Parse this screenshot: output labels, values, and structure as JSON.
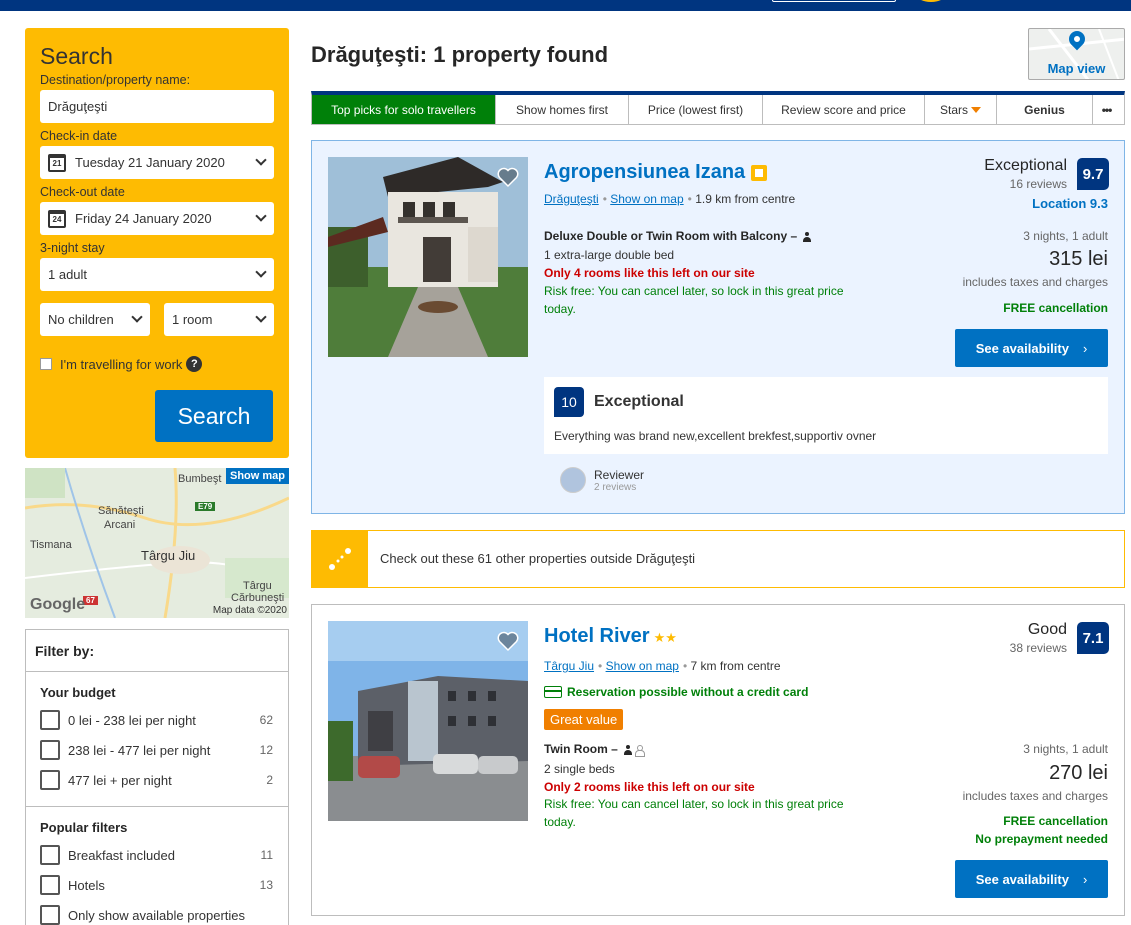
{
  "search": {
    "title": "Search",
    "dest_label": "Destination/property name:",
    "dest_value": "Drăguţeşti",
    "checkin_label": "Check-in date",
    "checkin_day": "21",
    "checkin_value": "Tuesday 21 January 2020",
    "checkout_label": "Check-out date",
    "checkout_day": "24",
    "checkout_value": "Friday 24 January 2020",
    "stay_label": "3-night stay",
    "adults": "1 adult",
    "children": "No children",
    "rooms": "1 room",
    "work_label": "I'm travelling for work",
    "button": "Search"
  },
  "minimap": {
    "show_map": "Show map",
    "towns": [
      "Bumbeşt",
      "Sănăteşti",
      "Arcani",
      "Tismana",
      "Târgu Jiu",
      "Târgu",
      "Cărbuneşti"
    ],
    "road": "E79",
    "road2": "67",
    "google": "Google",
    "map_data": "Map data ©2020"
  },
  "filter": {
    "title": "Filter by:",
    "budget_title": "Your budget",
    "budget": [
      {
        "label": "0 lei - 238 lei per night",
        "count": "62"
      },
      {
        "label": "238 lei - 477 lei per night",
        "count": "12"
      },
      {
        "label": "477 lei + per night",
        "count": "2"
      }
    ],
    "popular_title": "Popular filters",
    "popular": [
      {
        "label": "Breakfast included",
        "count": "11"
      },
      {
        "label": "Hotels",
        "count": "13"
      },
      {
        "label": "Only show available properties",
        "count": ""
      }
    ]
  },
  "main": {
    "title": "Drăguţeşti: 1 property found",
    "map_view": "Map view",
    "sort": [
      "Top picks for solo travellers",
      "Show homes first",
      "Price (lowest first)",
      "Review score and price",
      "Stars",
      "Genius",
      "•••"
    ]
  },
  "hotel1": {
    "name": "Agropensiunea Izana",
    "town": "Drăguţeşti",
    "show_on_map": "Show on map",
    "distance": "1.9 km from centre",
    "room": "Deluxe Double or Twin Room with Balcony",
    "bed": "1 extra-large double bed",
    "left": "Only 4 rooms like this left on our site",
    "risk": "Risk free: You can cancel later, so lock in this great price today.",
    "score_word": "Exceptional",
    "reviews": "16 reviews",
    "score": "9.7",
    "location": "Location 9.3",
    "nights": "3 nights, 1 adult",
    "price": "315 lei",
    "taxes": "includes taxes and charges",
    "free_cancel": "FREE cancellation",
    "button": "See availability",
    "review_score": "10",
    "review_word": "Exceptional",
    "review_text": "Everything was brand new,excellent brekfest,supportiv ovner",
    "reviewer": "Reviewer",
    "reviewer_count": "2 reviews"
  },
  "promo": {
    "text": "Check out these 61 other properties outside Drăguţeşti"
  },
  "hotel2": {
    "name": "Hotel River",
    "stars": "★★",
    "town": "Târgu Jiu",
    "show_on_map": "Show on map",
    "distance": "7 km from centre",
    "no_card": "Reservation possible without a credit card",
    "great_value": "Great value",
    "room": "Twin Room",
    "bed": "2 single beds",
    "left": "Only 2 rooms like this left on our site",
    "risk": "Risk free: You can cancel later, so lock in this great price today.",
    "score_word": "Good",
    "reviews": "38 reviews",
    "score": "7.1",
    "nights": "3 nights, 1 adult",
    "price": "270 lei",
    "taxes": "includes taxes and charges",
    "free_cancel": "FREE cancellation",
    "no_prepay": "No prepayment needed",
    "button": "See availability"
  }
}
